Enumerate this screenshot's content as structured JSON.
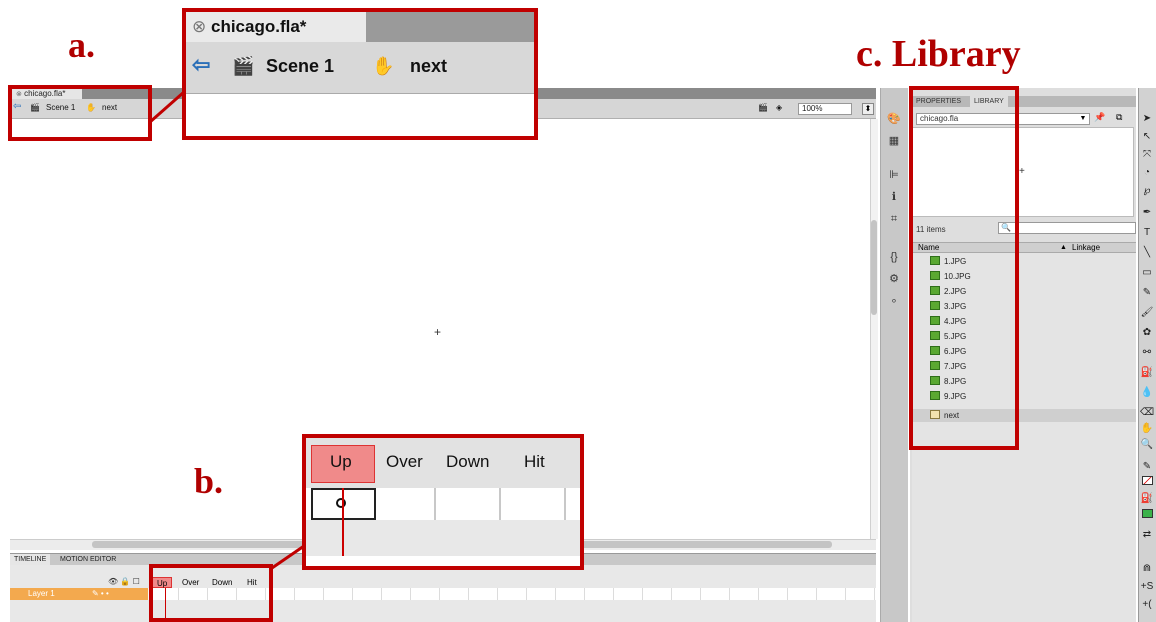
{
  "annotations": {
    "a_label": "a.",
    "b_label": "b.",
    "c_label": "c. Library"
  },
  "document": {
    "tab_title": "chicago.fla*",
    "breadcrumb": {
      "scene": "Scene 1",
      "symbol": "next"
    },
    "zoom": "100%",
    "stage_marker": "+"
  },
  "timeline": {
    "tabs": [
      "TIMELINE",
      "MOTION EDITOR"
    ],
    "frame_labels": [
      "Up",
      "Over",
      "Down",
      "Hit"
    ],
    "layer_name": "Layer 1"
  },
  "library": {
    "tabs": [
      "PROPERTIES",
      "LIBRARY"
    ],
    "document_select": "chicago.fla",
    "preview_marker": "+",
    "item_count": "11 items",
    "columns": {
      "name": "Name",
      "linkage": "Linkage"
    },
    "items": [
      "1.JPG",
      "10.JPG",
      "2.JPG",
      "3.JPG",
      "4.JPG",
      "5.JPG",
      "6.JPG",
      "7.JPG",
      "8.JPG",
      "9.JPG",
      "next"
    ]
  },
  "colors": {
    "annotation_red": "#c00000",
    "layer_orange": "#f3a94e",
    "frame_highlight": "#f08a8a",
    "bitmap_icon_green": "#5aa832",
    "fill_swatch": "#3bb24a"
  }
}
